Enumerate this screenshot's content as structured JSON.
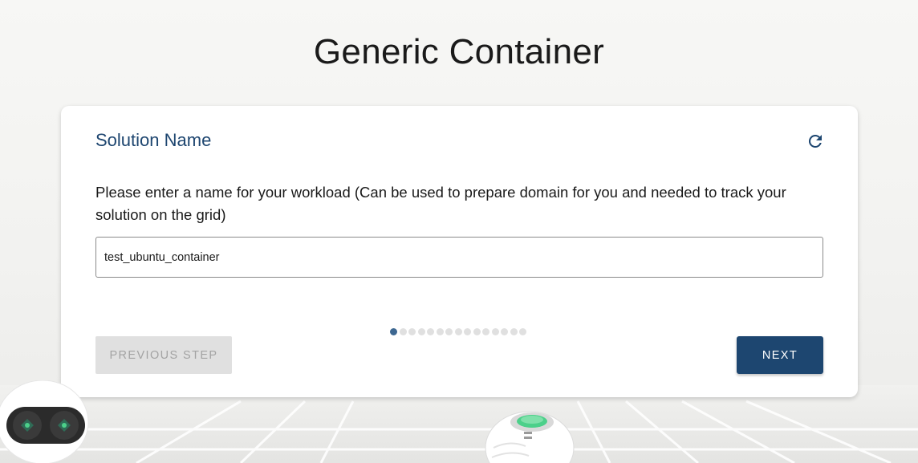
{
  "page": {
    "title": "Generic Container"
  },
  "card": {
    "title": "Solution Name",
    "refresh_icon": "refresh-icon",
    "description": "Please enter a name for your workload (Can be used to prepare domain for you and needed to track your solution on the grid)",
    "name_input": {
      "value": "test_ubuntu_container"
    },
    "steps": {
      "total": 15,
      "current": 1
    },
    "prev_label": "PREVIOUS STEP",
    "next_label": "NEXT"
  },
  "colors": {
    "accent": "#1d4670",
    "title_blue": "#1e4670",
    "active_dot": "#3d6791",
    "disabled_bg": "#e0e0e0",
    "disabled_text": "#a3a3a3",
    "robot_glow": "#4cd08a"
  }
}
